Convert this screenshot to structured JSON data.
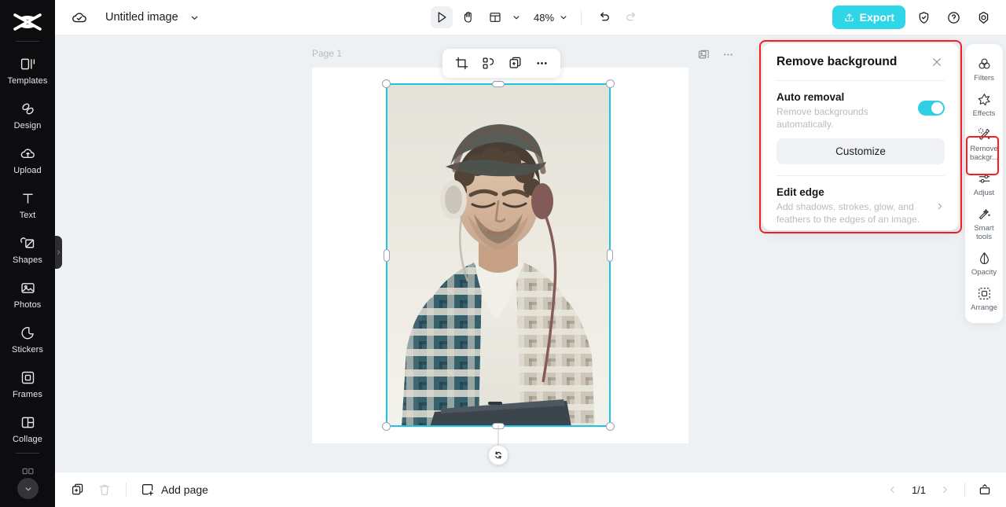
{
  "app": {
    "brand": "capcut-logo",
    "title": "Untitled image",
    "cloud_status_icon": "cloud-check-icon",
    "title_caret_icon": "chevron-down-icon"
  },
  "left_sidebar": {
    "items": [
      {
        "label": "Templates",
        "icon": "templates-icon"
      },
      {
        "label": "Design",
        "icon": "design-icon"
      },
      {
        "label": "Upload",
        "icon": "upload-cloud-icon"
      },
      {
        "label": "Text",
        "icon": "text-icon"
      },
      {
        "label": "Shapes",
        "icon": "shapes-icon"
      },
      {
        "label": "Photos",
        "icon": "photos-icon"
      },
      {
        "label": "Stickers",
        "icon": "stickers-icon"
      },
      {
        "label": "Frames",
        "icon": "frames-icon"
      },
      {
        "label": "Collage",
        "icon": "collage-icon"
      }
    ],
    "more_icon": "more-apps-icon",
    "collapse_icon": "chevron-down-icon",
    "edge_handle_icon": "chevron-right-icon"
  },
  "toolbar": {
    "select_tool_icon": "cursor-arrow-icon",
    "hand_tool_icon": "hand-icon",
    "layout_tool_icon": "layout-panel-icon",
    "layout_caret_icon": "chevron-down-icon",
    "zoom_value": "48%",
    "zoom_caret_icon": "chevron-down-icon",
    "undo_icon": "undo-arrow-icon",
    "redo_icon": "redo-arrow-icon",
    "export_label": "Export",
    "export_icon": "upload-share-icon",
    "export_color": "#2fd6e8",
    "shield_icon": "shield-check-icon",
    "help_icon": "question-circle-icon",
    "settings_icon": "settings-gear-icon"
  },
  "canvas": {
    "page_label": "Page 1",
    "background_color": "#eef1f4",
    "page_color": "#ffffff",
    "selection_color": "#19c6e6",
    "object_toolbar": [
      {
        "icon": "crop-icon",
        "name": "crop-button"
      },
      {
        "icon": "remove-background-icon",
        "name": "cutout-button"
      },
      {
        "icon": "duplicate-icon",
        "name": "duplicate-button"
      },
      {
        "icon": "more-horizontal-icon",
        "name": "more-options-button"
      }
    ],
    "corner_icons": [
      {
        "icon": "image-layers-icon",
        "name": "page-thumbnail-button"
      },
      {
        "icon": "more-horizontal-icon",
        "name": "page-more-button"
      }
    ],
    "rotate_icon": "rotate-icon",
    "image_alt": "Man with flat cap and headphones using a laptop"
  },
  "remove_background_panel": {
    "title": "Remove background",
    "close_icon": "close-x-icon",
    "highlight_color": "#fb1b22",
    "auto_removal": {
      "title": "Auto removal",
      "description": "Remove backgrounds automatically.",
      "toggle_on": true,
      "toggle_color": "#2fd0e4"
    },
    "customize_label": "Customize",
    "edit_edge": {
      "title": "Edit edge",
      "description": "Add shadows, strokes, glow, and feathers to the edges of an image.",
      "chevron_icon": "chevron-right-icon"
    }
  },
  "right_rail": {
    "items": [
      {
        "label": "Filters",
        "icon": "filters-icon",
        "selected": false
      },
      {
        "label": "Effects",
        "icon": "effects-sparkle-icon",
        "selected": false
      },
      {
        "label": "Remove backgr...",
        "icon": "remove-background-icon",
        "selected": true
      },
      {
        "label": "Adjust",
        "icon": "adjust-sliders-icon",
        "selected": false
      },
      {
        "label": "Smart tools",
        "icon": "magic-wand-icon",
        "selected": false
      },
      {
        "label": "Opacity",
        "icon": "opacity-drop-icon",
        "selected": false
      },
      {
        "label": "Arrange",
        "icon": "arrange-icon",
        "selected": false
      }
    ]
  },
  "bottom_bar": {
    "duplicate_page_icon": "duplicate-page-icon",
    "delete_page_icon": "trash-icon",
    "add_page_label": "Add page",
    "add_page_icon": "add-page-icon",
    "prev_icon": "chevron-left-icon",
    "next_icon": "chevron-right-icon",
    "page_indicator": "1/1",
    "presentation_icon": "present-icon"
  }
}
